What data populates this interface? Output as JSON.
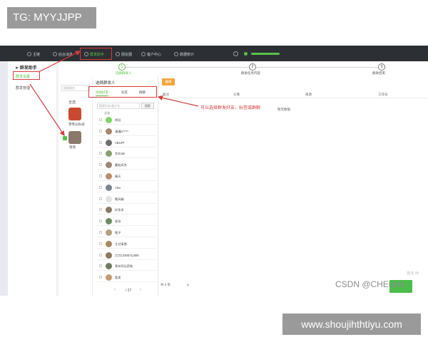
{
  "overlay": {
    "tg_tag": "TG: MYYJJPP",
    "site_tag": "www.shoujihthtiyu.com",
    "watermark": "CSDN @CHEuzki",
    "win_watermark": "激活 Wi"
  },
  "topbar": {
    "items": [
      {
        "label": "主链",
        "icon": "home-icon"
      },
      {
        "label": "后台消息",
        "icon": "message-icon"
      },
      {
        "label": "群发助手",
        "icon": "send-icon",
        "active": true
      },
      {
        "label": "朋友圈",
        "icon": "moments-icon"
      },
      {
        "label": "客户中心",
        "icon": "user-icon"
      },
      {
        "label": "数据统计",
        "icon": "chart-icon"
      }
    ]
  },
  "sidebar": {
    "title": "群发助手",
    "items": [
      {
        "label": "群发设置",
        "active": true
      },
      {
        "label": "群发管理",
        "active": false
      }
    ]
  },
  "steps": [
    {
      "number": "1",
      "label": "选择群发人",
      "done": true
    },
    {
      "number": "2",
      "label": "群发任务内容",
      "done": false
    },
    {
      "number": "3",
      "label": "群发结束",
      "done": false
    }
  ],
  "groups": {
    "search_placeholder": "搜索微信",
    "label": "全选",
    "items": [
      {
        "name": "零零@私域",
        "checked": false
      },
      {
        "name": "落落",
        "checked": true
      }
    ]
  },
  "selection": {
    "title": "选择群发人",
    "tabs": [
      {
        "label": "添加好友",
        "active": true
      },
      {
        "label": "标签",
        "active": false
      },
      {
        "label": "群聊",
        "active": false
      }
    ],
    "search_placeholder": "搜索好友/备注名",
    "search_button": "搜索",
    "select_all": "全选",
    "contacts": [
      {
        "name": "明月",
        "color": "#7fd36b"
      },
      {
        "name": "漫漫a*****",
        "color": "#a7876a"
      },
      {
        "name": "ABUFF",
        "color": "#6f6f6f"
      },
      {
        "name": "艾shaki",
        "color": "#8aa06e"
      },
      {
        "name": "霍若风克",
        "color": "#9c8875"
      },
      {
        "name": "晴天",
        "color": "#b98e6f"
      },
      {
        "name": "Alex",
        "color": "#7c8590"
      },
      {
        "name": "晚风确",
        "color": "#e2e2e2"
      },
      {
        "name": "好多多 ",
        "color": "#8c7a68"
      },
      {
        "name": "老张",
        "color": "#6d8b62"
      },
      {
        "name": "瓶子",
        "color": "#b3a07d"
      },
      {
        "name": "主讨清雪",
        "color": "#a9875f"
      },
      {
        "name": "刀刀13385711888",
        "color": "#8f7760"
      },
      {
        "name": "青年阿坛荷和",
        "color": "#6d7a60"
      },
      {
        "name": "柔柔",
        "color": "#c59a72"
      }
    ],
    "page_total": "27"
  },
  "table": {
    "add_button": "编辑",
    "headers": [
      "备注",
      "头像",
      "来源",
      "工作号"
    ],
    "no_data": "暂无数据",
    "footer_total": "共 0 条",
    "footer_page": "1"
  },
  "annotation": "可以选择群发好友，标签或群聊"
}
